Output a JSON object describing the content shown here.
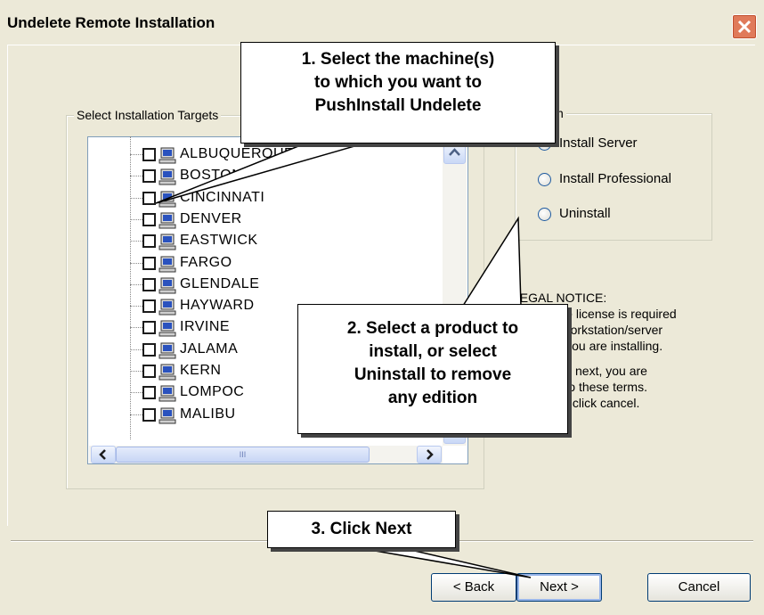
{
  "window": {
    "title": "Undelete Remote Installation"
  },
  "targets": {
    "legend": "Select Installation Targets",
    "machines": [
      {
        "name": "ALBUQUERQUE",
        "checked": false
      },
      {
        "name": "BOSTON",
        "checked": false
      },
      {
        "name": "CINCINNATI",
        "checked": false
      },
      {
        "name": "DENVER",
        "checked": false
      },
      {
        "name": "EASTWICK",
        "checked": false
      },
      {
        "name": "FARGO",
        "checked": false
      },
      {
        "name": "GLENDALE",
        "checked": false
      },
      {
        "name": "HAYWARD",
        "checked": false
      },
      {
        "name": "IRVINE",
        "checked": false
      },
      {
        "name": "JALAMA",
        "checked": false
      },
      {
        "name": "KERN",
        "checked": false
      },
      {
        "name": "LOMPOC",
        "checked": false
      },
      {
        "name": "MALIBU",
        "checked": false
      }
    ],
    "hscroll_thumb": "III"
  },
  "edition": {
    "legend": "Edition",
    "options": [
      {
        "label": "Install Server",
        "checked": true
      },
      {
        "label": "Install Professional",
        "checked": false
      },
      {
        "label": "Uninstall",
        "checked": false
      }
    ]
  },
  "legal": {
    "heading": "LEGAL NOTICE:",
    "line1": "A separate license is required",
    "line2": "for each workstation/server",
    "line3": "on which you are installing.",
    "line4": "By clicking next, you are",
    "line5": "agreeing to these terms.",
    "line6": "Otherwise click cancel."
  },
  "buttons": {
    "back": "< Back",
    "next": "Next >",
    "cancel": "Cancel"
  },
  "callouts": {
    "c1": [
      "1. Select the machine(s)",
      "to which you want to",
      "PushInstall Undelete"
    ],
    "c2": [
      "2. Select a product to",
      "install, or select",
      "Uninstall to remove",
      "any edition"
    ],
    "c3": "3. Click Next"
  },
  "colors": {
    "dialog_bg": "#ece9d8",
    "close_button": "#e07a5a",
    "radio_dot": "#23a02a"
  }
}
